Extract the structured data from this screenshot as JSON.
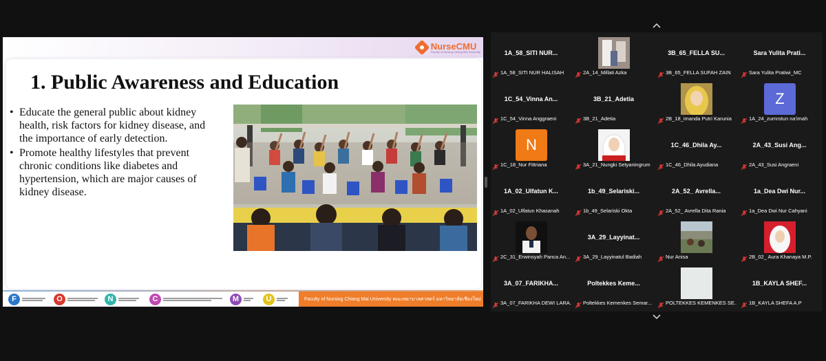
{
  "slide": {
    "brand_name": "NurseCMU",
    "brand_subtitle": "Faculty of Nursing Chiang Mai University",
    "title": "1. Public Awareness and Education",
    "bullets": [
      "Educate the general public about kidney health, risk factors for kidney disease, and the importance of early detection.",
      "Promote healthy lifestyles that prevent chronic conditions like diabetes and hypertension, which are major causes of kidney disease."
    ],
    "footer_badges": [
      {
        "letter": "F",
        "color": "#2a77c9"
      },
      {
        "letter": "O",
        "color": "#d8382e"
      },
      {
        "letter": "N",
        "color": "#2db5a8"
      },
      {
        "letter": "C",
        "color": "#c04ab3"
      },
      {
        "letter": "M",
        "color": "#8e4bb5"
      },
      {
        "letter": "U",
        "color": "#e4c319"
      }
    ],
    "footer_faculty": "Faculty of Nursing Chiang Mai University คณะพยาบาลศาสตร์ มหาวิทยาลัยเชียงใหม่"
  },
  "participants": [
    {
      "name": "1A_58_SITI NUR...",
      "label": "1A_58_SITI NUR HALISAH",
      "avatar": "none"
    },
    {
      "name": "",
      "label": "2A_14_Millati Azka",
      "avatar": "photo-room"
    },
    {
      "name": "3B_65_FELLA SU...",
      "label": "3B_65_FELLA SUFAH ZAIN",
      "avatar": "none"
    },
    {
      "name": "Sara Yulita Prati...",
      "label": "Sara Yulita Pratiwi_MC",
      "avatar": "none"
    },
    {
      "name": "1C_54_Vinna An...",
      "label": "1C_54_Vinna Anggraeni",
      "avatar": "none"
    },
    {
      "name": "3B_21_Adetia",
      "label": "3B_21_Adetia",
      "avatar": "none"
    },
    {
      "name": "",
      "label": "2B_18_imanda Putri Karunia",
      "avatar": "photo-hijab-yellow"
    },
    {
      "name": "",
      "label": "1A_24_zumrotun na'imah",
      "avatar": "letter",
      "letter": "Z",
      "color": "#5b6ad6"
    },
    {
      "name": "",
      "label": "1C_18_Nur Fittriana",
      "avatar": "letter",
      "letter": "N",
      "color": "#ef7a16"
    },
    {
      "name": "",
      "label": "3A_21_Nungki Setyaningrum",
      "avatar": "photo-hijab-red"
    },
    {
      "name": "1C_46_Dhila Ay...",
      "label": "1C_46_Dhila Ayudiana",
      "avatar": "none"
    },
    {
      "name": "2A_43_Susi Ang...",
      "label": "2A_43_Susi Angraeni",
      "avatar": "none"
    },
    {
      "name": "1A_02_Ulfatun K...",
      "label": "1A_02_Ulfatun Khasanah",
      "avatar": "none"
    },
    {
      "name": "1b_49_Selariski...",
      "label": "1b_49_Selariski Okta",
      "avatar": "none"
    },
    {
      "name": "2A_52_ Avrella...",
      "label": "2A_52_ Avrella Dita Rania",
      "avatar": "none"
    },
    {
      "name": "1a_Dea Dwi Nur...",
      "label": "1a_Dea Dwi Nur Cahyani",
      "avatar": "none"
    },
    {
      "name": "",
      "label": "2C_31_Erwinsyah Panca An...",
      "avatar": "photo-man"
    },
    {
      "name": "3A_29_Layyinat...",
      "label": "3A_29_Layyinatul Badiah",
      "avatar": "none"
    },
    {
      "name": "",
      "label": "Nur Anisa",
      "avatar": "photo-outdoor"
    },
    {
      "name": "",
      "label": "2B_02_ Aura Khanaya M.P.",
      "avatar": "photo-hijab-white"
    },
    {
      "name": "3A_07_FARIKHA...",
      "label": "3A_07_FARIKHA DEWI LARA...",
      "avatar": "none"
    },
    {
      "name": "Poltekkes Keme...",
      "label": "Poltekkes Kemenkes Semar...",
      "avatar": "none"
    },
    {
      "name": "",
      "label": "POLTEKKES KEMENKES SE...",
      "avatar": "photo-blank"
    },
    {
      "name": "1B_KAYLA SHEF...",
      "label": "1B_KAYLA SHEFA A.P",
      "avatar": "none"
    }
  ]
}
